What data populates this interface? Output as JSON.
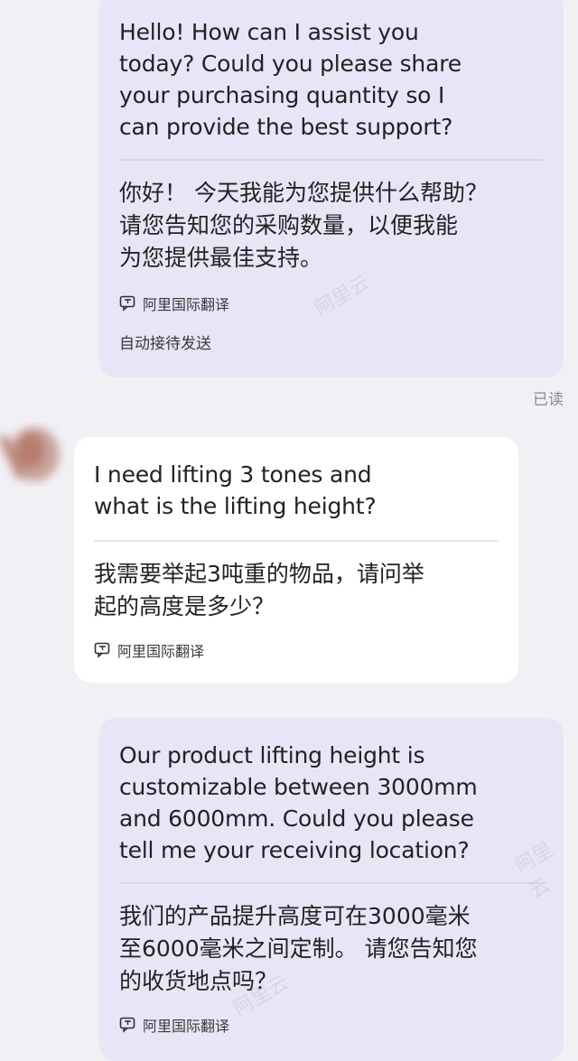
{
  "messages": [
    {
      "direction": "outgoing",
      "text_en": "Hello! How can I assist you\ntoday? Could you please share\nyour purchasing quantity so I\ncan provide the best support?",
      "text_zh": "你好！ 今天我能为您提供什么帮助？\n请您告知您的采购数量，以便我能\n为您提供最佳支持。",
      "translator": "阿里国际翻译",
      "auto_send": "自动接待发送",
      "status": "已读"
    },
    {
      "direction": "incoming",
      "text_en": "I need lifting 3 tones and\nwhat is the lifting height?",
      "text_zh": "我需要举起3吨重的物品，请问举\n起的高度是多少？",
      "translator": "阿里国际翻译"
    },
    {
      "direction": "outgoing",
      "text_en": "Our product lifting height is\ncustomizable between 3000mm\nand 6000mm. Could you please\ntell me your receiving location?",
      "text_zh": "我们的产品提升高度可在3000毫米\n至6000毫米之间定制。 请您告知您\n的收货地点吗？",
      "translator": "阿里国际翻译"
    }
  ],
  "watermark": "阿里云",
  "colors": {
    "background": "#f1f0f5",
    "outgoing_bubble": "#e6e6f7",
    "incoming_bubble": "#ffffff"
  }
}
